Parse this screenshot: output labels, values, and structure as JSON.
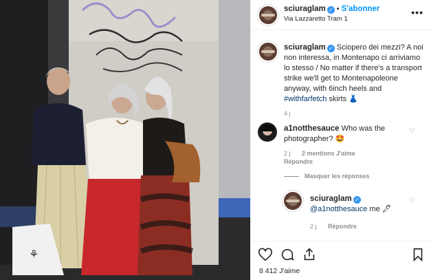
{
  "post": {
    "username": "sciuraglam",
    "follow_label": "S'abonner",
    "separator": "•",
    "location": "Via Lazzaretto Tram 1",
    "likes": "8 412 J'aime"
  },
  "caption": {
    "username": "sciuraglam",
    "text_main": "Sciopero dei mezzi? A noi non interessa, in Montenapo ci arriviamo lo stesso / No matter if there's a transport strike we'll get to Montenapoleone anyway, with 6inch heels and ",
    "hashtag": "#withfarfetch",
    "text_end": " skirts 👗",
    "time": "4 j"
  },
  "comments": [
    {
      "username": "a1notthesauce",
      "text": "Who was the photographer? 🤩",
      "time": "2 j",
      "likes": "2 mentions J'aime",
      "reply_label": "Répondre",
      "hide_replies": "Masquer les réponses"
    }
  ],
  "reply": {
    "username": "sciuraglam",
    "mention": "@a1notthesauce",
    "text": " me 🖋",
    "time": "2 j",
    "reply_label": "Répondre"
  },
  "icons": {
    "verified": "verified-badge",
    "more": "more-options",
    "like": "heart",
    "comment": "speech-bubble",
    "share": "paper-plane",
    "save": "bookmark"
  },
  "colors": {
    "link_blue": "#0095f6",
    "verified_blue": "#3897f0",
    "secondary_text": "#8e8e8e",
    "text": "#262626",
    "divider": "#efefef"
  }
}
